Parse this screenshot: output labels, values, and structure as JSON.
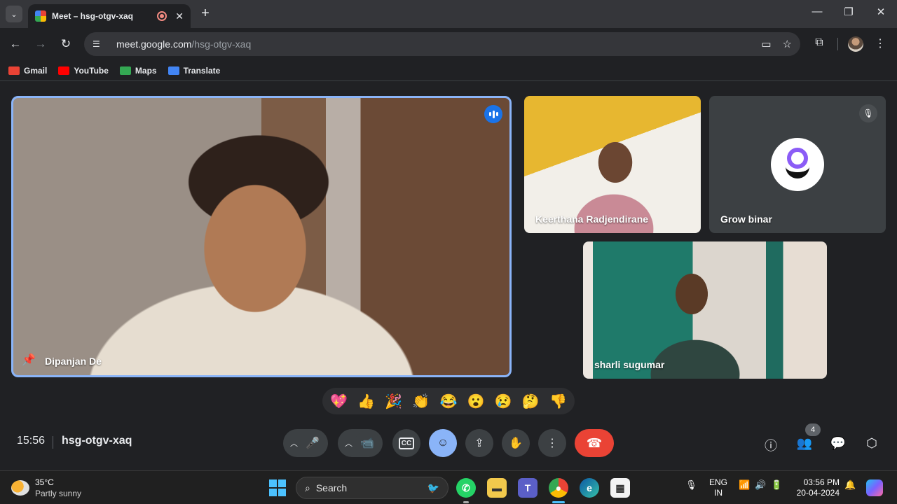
{
  "browser": {
    "tab_title": "Meet – hsg-otgv-xaq",
    "url_host": "meet.google.com",
    "url_path": "/hsg-otgv-xaq",
    "bookmarks": [
      {
        "label": "Gmail",
        "color": "#ea4335"
      },
      {
        "label": "YouTube",
        "color": "#ff0000"
      },
      {
        "label": "Maps",
        "color": "#34a853"
      },
      {
        "label": "Translate",
        "color": "#4285f4"
      }
    ]
  },
  "meet": {
    "participants": {
      "main": "Dipanjan De",
      "top_left": "Keerthana Radjendirane",
      "top_right": "Grow binar",
      "bottom": "sharli sugumar"
    },
    "reactions": [
      "💖",
      "👍",
      "🎉",
      "👏",
      "😂",
      "😮",
      "😢",
      "🤔",
      "👎"
    ],
    "time": "15:56",
    "meeting_code": "hsg-otgv-xaq",
    "people_count": "4",
    "accent_color": "#8ab4f8",
    "end_call_color": "#ea4335"
  },
  "taskbar": {
    "weather_temp": "35°C",
    "weather_desc": "Partly sunny",
    "search_label": "Search",
    "lang_line1": "ENG",
    "lang_line2": "IN",
    "time": "03:56 PM",
    "date": "20-04-2024"
  }
}
